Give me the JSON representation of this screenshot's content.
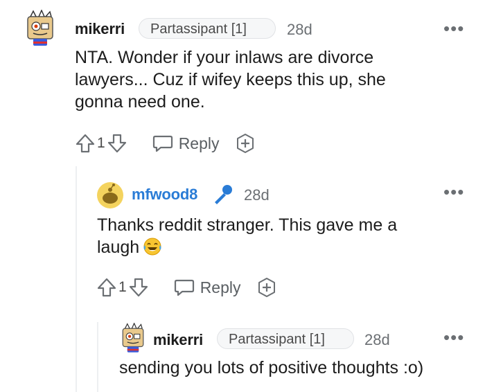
{
  "comments": [
    {
      "username": "mikerri",
      "flair": "Partassipant [1]",
      "time": "28d",
      "body": "NTA. Wonder if your inlaws are divorce lawyers... Cuz if wifey keeps this up, she gonna need one.",
      "score": "1",
      "reply_label": "Reply"
    },
    {
      "username": "mfwood8",
      "time": "28d",
      "body": "Thanks reddit stranger. This gave me a laugh",
      "score": "1",
      "reply_label": "Reply"
    },
    {
      "username": "mikerri",
      "flair": "Partassipant [1]",
      "time": "28d",
      "body": "sending you lots of positive thoughts :o)"
    }
  ],
  "icons": {
    "more": "more-options-icon",
    "upvote": "upvote-arrow-icon",
    "downvote": "downvote-arrow-icon",
    "reply": "speech-bubble-icon",
    "award": "award-plus-icon",
    "mic": "microphone-icon",
    "emoji": "laughing-tears-emoji"
  },
  "colors": {
    "mod_name": "#2a7cd6",
    "mic": "#2a7cd6"
  }
}
